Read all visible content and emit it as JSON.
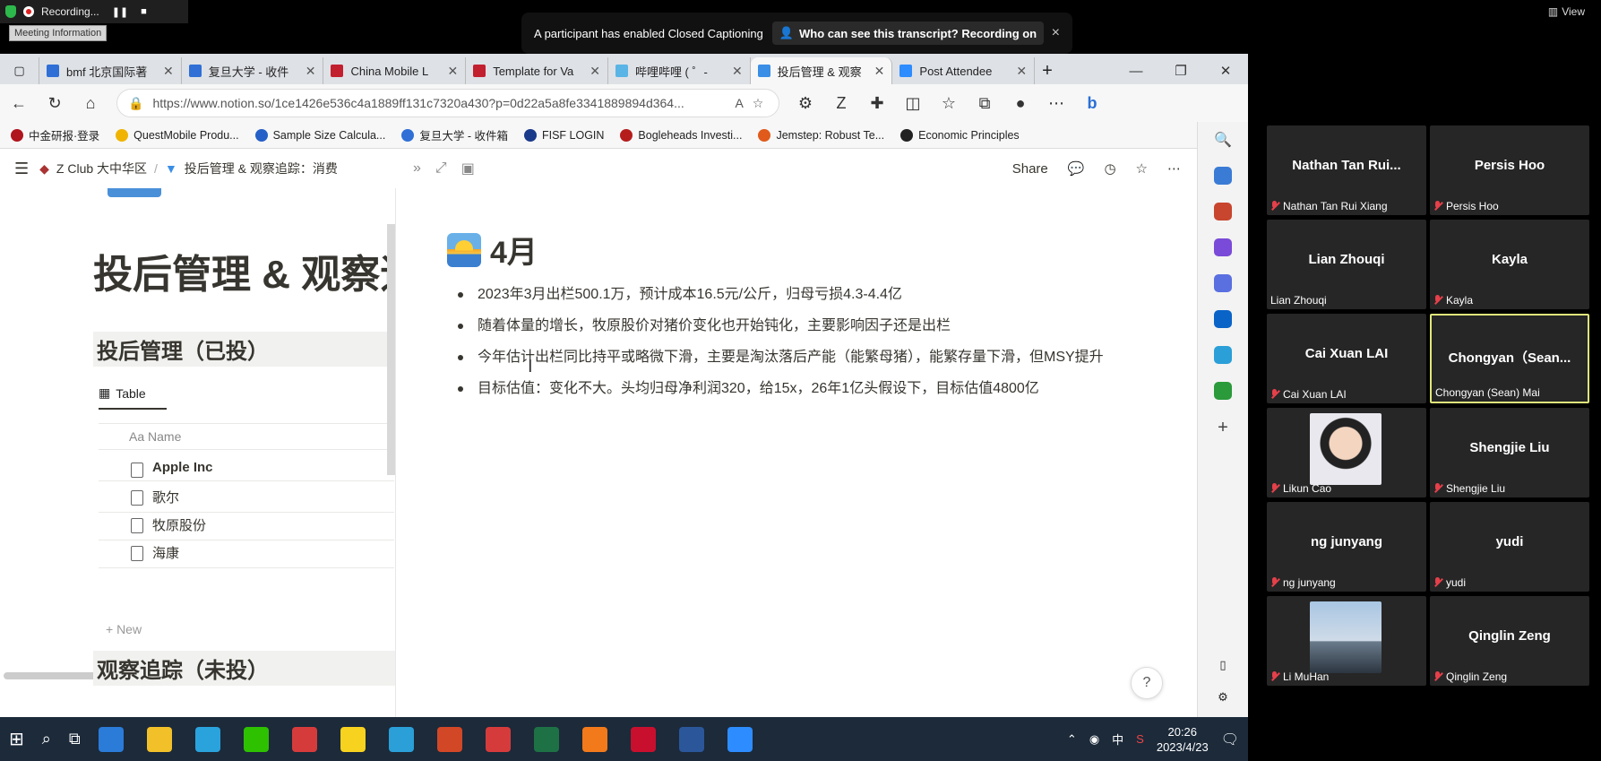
{
  "recording": {
    "label": "Recording...",
    "meeting_info": "Meeting Information"
  },
  "cc_toast": {
    "message": "A participant has enabled Closed Captioning",
    "who_label": "Who can see this transcript? Recording on",
    "close": "×"
  },
  "view_button": "View",
  "tabs": [
    {
      "title": "bmf 北京国际著",
      "color": "#2f6fd6"
    },
    {
      "title": "复旦大学 - 收件",
      "color": "#2f6fd6"
    },
    {
      "title": "China Mobile L",
      "color": "#c21f2f"
    },
    {
      "title": "Template for Va",
      "color": "#c21f2f"
    },
    {
      "title": "哔哩哔哩 ( ゜-",
      "color": "#5ab4e5"
    },
    {
      "title": "投后管理 & 观察",
      "color": "#3a8ee6",
      "active": true
    },
    {
      "title": "Post Attendee",
      "color": "#2d8cff"
    }
  ],
  "new_tab": "+",
  "window_controls": {
    "minimize": "—",
    "restore": "❐",
    "close": "✕"
  },
  "address": {
    "url": "https://www.notion.so/1ce1426e536c4a1889ff131c7320a430?p=0d22a5a8fe3341889894d364..."
  },
  "bookmarks": [
    {
      "label": "中金研报·登录",
      "color": "#b0141c"
    },
    {
      "label": "QuestMobile Produ...",
      "color": "#f0b400"
    },
    {
      "label": "Sample Size Calcula...",
      "color": "#2560c8"
    },
    {
      "label": "复旦大学 - 收件箱",
      "color": "#2f6fd6"
    },
    {
      "label": "FISF LOGIN",
      "color": "#1a3a8a"
    },
    {
      "label": "Bogleheads Investi...",
      "color": "#b51d1d"
    },
    {
      "label": "Jemstep: Robust Te...",
      "color": "#e05a1c"
    },
    {
      "label": "Economic Principles",
      "color": "#222222"
    }
  ],
  "notion": {
    "breadcrumb": [
      "Z Club 大中华区",
      "/",
      "投后管理 & 观察追踪：消费"
    ],
    "share": "Share",
    "left": {
      "page_title": "投后管理 & 观察追",
      "section1": "投后管理（已投）",
      "db_tab": "Table",
      "col_name": "Name",
      "rows": [
        "Apple Inc",
        "歌尔",
        "牧原股份",
        "海康"
      ],
      "new": "+ New",
      "section2": "观察追踪（未投）"
    },
    "heading": "4月",
    "bullets": [
      "2023年3月出栏500.1万，预计成本16.5元/公斤，归母亏损4.3-4.4亿",
      "随着体量的增长，牧原股价对猪价变化也开始钝化，主要影响因子还是出栏",
      "今年估计出栏同比持平或略微下滑，主要是淘汰落后产能（能繁母猪），能繁存量下滑，但MSY提升",
      "目标估值：变化不大。头均归母净利润320，给15x，26年1亿头假设下，目标估值4800亿"
    ],
    "help": "?"
  },
  "participants": [
    {
      "name": "Nathan Tan Rui...",
      "label": "Nathan Tan Rui Xiang",
      "muted": true
    },
    {
      "name": "Persis Hoo",
      "label": "Persis Hoo",
      "muted": true
    },
    {
      "name": "Lian Zhouqi",
      "label": "Lian Zhouqi",
      "muted": false
    },
    {
      "name": "Kayla",
      "label": "Kayla",
      "muted": true
    },
    {
      "name": "Cai Xuan LAI",
      "label": "Cai Xuan LAI",
      "muted": true
    },
    {
      "name": "Chongyan（Sean...",
      "label": "Chongyan (Sean) Mai",
      "muted": false,
      "active": true
    },
    {
      "name": "",
      "label": "Likun Cao",
      "muted": true,
      "photo": "likun"
    },
    {
      "name": "Shengjie Liu",
      "label": "Shengjie Liu",
      "muted": true
    },
    {
      "name": "ng junyang",
      "label": "ng junyang",
      "muted": true
    },
    {
      "name": "yudi",
      "label": "yudi",
      "muted": true
    },
    {
      "name": "",
      "label": "Li MuHan",
      "muted": true,
      "photo": "limuhan"
    },
    {
      "name": "Qinglin Zeng",
      "label": "Qinglin Zeng",
      "muted": true
    }
  ],
  "taskbar": {
    "apps": [
      {
        "name": "mail",
        "color": "#2b7bd8"
      },
      {
        "name": "file-explorer",
        "color": "#f2c029"
      },
      {
        "name": "telegram",
        "color": "#2aa3dd"
      },
      {
        "name": "wechat",
        "color": "#2dc100"
      },
      {
        "name": "wps",
        "color": "#d63b3b"
      },
      {
        "name": "sticky-notes",
        "color": "#f7d21e"
      },
      {
        "name": "edge",
        "color": "#2a9fd8"
      },
      {
        "name": "powerpoint",
        "color": "#d24726"
      },
      {
        "name": "wps-writer",
        "color": "#d63b3b"
      },
      {
        "name": "excel",
        "color": "#1e7145"
      },
      {
        "name": "todo",
        "color": "#f27a1a"
      },
      {
        "name": "acrobat",
        "color": "#c8102e"
      },
      {
        "name": "word",
        "color": "#2b579a"
      },
      {
        "name": "zoom",
        "color": "#2d8cff"
      }
    ],
    "ime": "中",
    "time": "20:26",
    "date": "2023/4/23"
  }
}
